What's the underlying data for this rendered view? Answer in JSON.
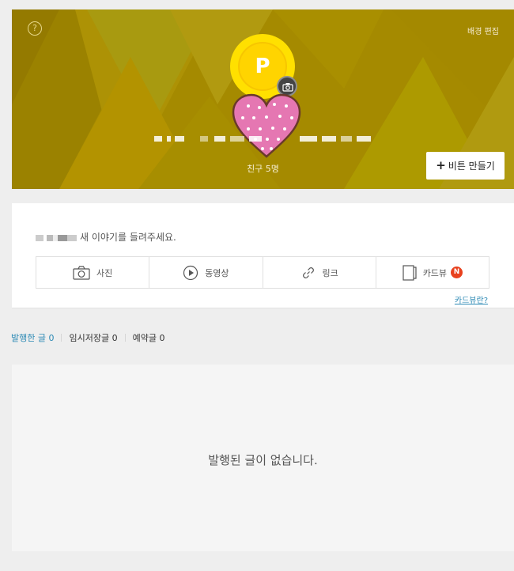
{
  "cover": {
    "help_symbol": "?",
    "edit_background_label": "배경 편집",
    "profile_symbol": "P",
    "friends_label": "친구 5명",
    "make_button_label": "비튼 만들기",
    "make_button_plus": "+"
  },
  "composer": {
    "prompt_text": "새 이야기를 들려주세요.",
    "tools": [
      {
        "label": "사진",
        "icon": "camera-icon"
      },
      {
        "label": "동영상",
        "icon": "play-icon"
      },
      {
        "label": "링크",
        "icon": "link-icon"
      },
      {
        "label": "카드뷰",
        "icon": "cardview-icon",
        "badge": "N"
      }
    ],
    "help_link": "카드뷰란?"
  },
  "tabs": [
    {
      "label": "발행한 글 0",
      "active": true
    },
    {
      "label": "임시저장글 0",
      "active": false
    },
    {
      "label": "예약글 0",
      "active": false
    }
  ],
  "empty_message": "발행된 글이 없습니다.",
  "colors": {
    "cover_bg": "#a58a00",
    "accent_blue": "#2d8ab5",
    "badge_red": "#e8411e",
    "profile_yellow": "#ffe000",
    "heart_pink": "#e577b2"
  }
}
